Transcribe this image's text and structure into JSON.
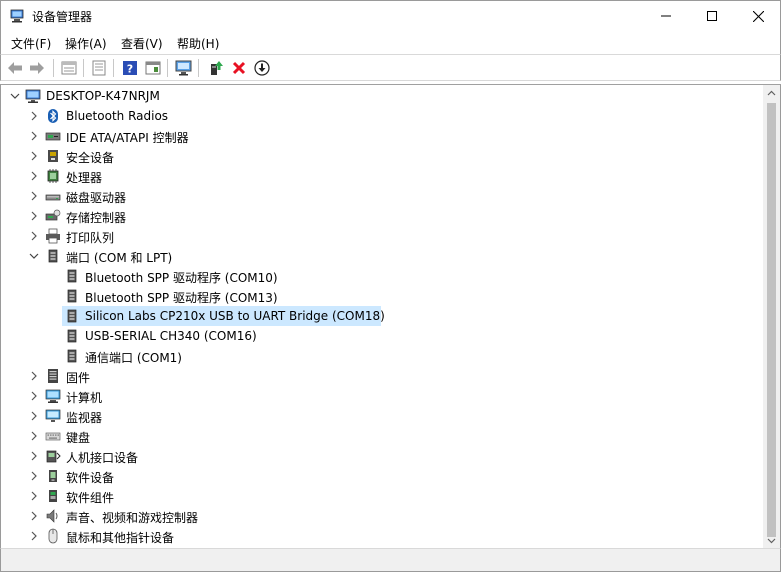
{
  "window": {
    "title": "设备管理器"
  },
  "menu": [
    "文件(F)",
    "操作(A)",
    "查看(V)",
    "帮助(H)"
  ],
  "toolbar": [
    {
      "name": "back-icon"
    },
    {
      "name": "forward-icon"
    },
    {
      "name": "properties-icon"
    },
    {
      "name": "update-icon"
    },
    {
      "name": "help-icon"
    },
    {
      "name": "view-icon"
    },
    {
      "name": "scan-hardware-icon"
    },
    {
      "name": "enable-device-icon"
    },
    {
      "name": "uninstall-icon"
    },
    {
      "name": "download-driver-icon"
    }
  ],
  "tree": {
    "root": "DESKTOP-K47NRJM",
    "categories": [
      {
        "label": "Bluetooth Radios",
        "icon": "bluetooth-icon"
      },
      {
        "label": "IDE ATA/ATAPI 控制器",
        "icon": "ide-controller-icon"
      },
      {
        "label": "安全设备",
        "icon": "security-device-icon"
      },
      {
        "label": "处理器",
        "icon": "processor-icon"
      },
      {
        "label": "磁盘驱动器",
        "icon": "disk-drive-icon"
      },
      {
        "label": "存储控制器",
        "icon": "storage-controller-icon"
      },
      {
        "label": "打印队列",
        "icon": "printer-icon"
      },
      {
        "label": "端口 (COM 和 LPT)",
        "icon": "port-icon",
        "expanded": true,
        "children": [
          "Bluetooth SPP 驱动程序 (COM10)",
          "Bluetooth SPP 驱动程序 (COM13)",
          "Silicon Labs CP210x USB to UART Bridge (COM18)",
          "USB-SERIAL CH340 (COM16)",
          "通信端口 (COM1)"
        ],
        "selected_child": 2
      },
      {
        "label": "固件",
        "icon": "firmware-icon"
      },
      {
        "label": "计算机",
        "icon": "computer-icon"
      },
      {
        "label": "监视器",
        "icon": "monitor-icon"
      },
      {
        "label": "键盘",
        "icon": "keyboard-icon"
      },
      {
        "label": "人机接口设备",
        "icon": "hid-icon"
      },
      {
        "label": "软件设备",
        "icon": "software-device-icon"
      },
      {
        "label": "软件组件",
        "icon": "software-component-icon"
      },
      {
        "label": "声音、视频和游戏控制器",
        "icon": "sound-icon"
      },
      {
        "label": "鼠标和其他指针设备",
        "icon": "mouse-icon"
      }
    ]
  },
  "colors": {
    "selection": "#cce8ff",
    "accent": "#0078d7",
    "delete": "#e81123"
  }
}
